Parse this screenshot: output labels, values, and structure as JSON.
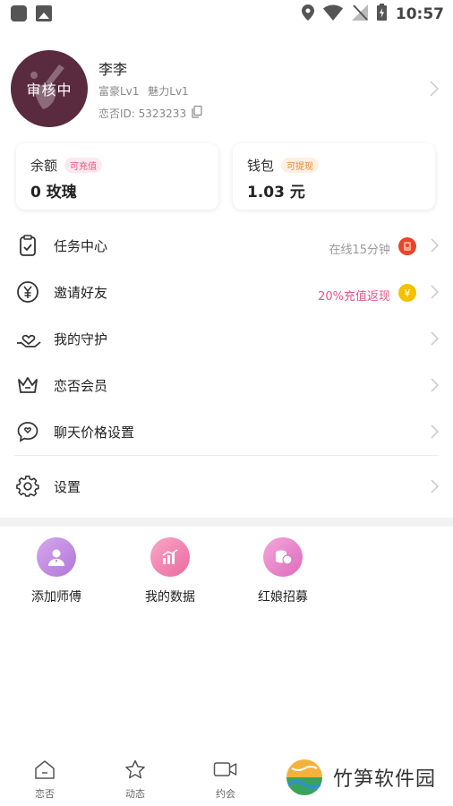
{
  "status_bar": {
    "time": "10:57"
  },
  "profile": {
    "avatar_badge": "审核中",
    "nickname": "李李",
    "level_rich": "富豪Lv1",
    "level_charm": "魅力Lv1",
    "uid": "恋否ID: 5323233"
  },
  "balance_card": {
    "title": "余额",
    "tag": "可充值",
    "value": "0 玫瑰"
  },
  "wallet_card": {
    "title": "钱包",
    "tag": "可提现",
    "value": "1.03 元"
  },
  "menu": {
    "tasks": {
      "label": "任务中心",
      "right_text": "在线15分钟"
    },
    "invite": {
      "label": "邀请好友",
      "right_text": "20%充值返现"
    },
    "guard": {
      "label": "我的守护"
    },
    "vip": {
      "label": "恋否会员"
    },
    "chat_price": {
      "label": "聊天价格设置"
    },
    "settings": {
      "label": "设置"
    }
  },
  "shortcuts": [
    {
      "label": "添加师傅",
      "icon": "person-icon",
      "color": "#c58ae0"
    },
    {
      "label": "我的数据",
      "icon": "chart-icon",
      "color": "#f07aa8"
    },
    {
      "label": "红娘招募",
      "icon": "coins-icon",
      "color": "#e77fc2"
    }
  ],
  "bottom_nav": [
    {
      "label": "恋否",
      "icon": "home-icon"
    },
    {
      "label": "动态",
      "icon": "star-icon"
    },
    {
      "label": "约会",
      "icon": "video-icon"
    }
  ],
  "watermark": {
    "text": "竹笋软件园"
  },
  "colors": {
    "accent_pink": "#e25689",
    "avatar_bg": "#5a2a3e",
    "coin_yellow": "#f2c200",
    "badge_red": "#e8452c"
  }
}
